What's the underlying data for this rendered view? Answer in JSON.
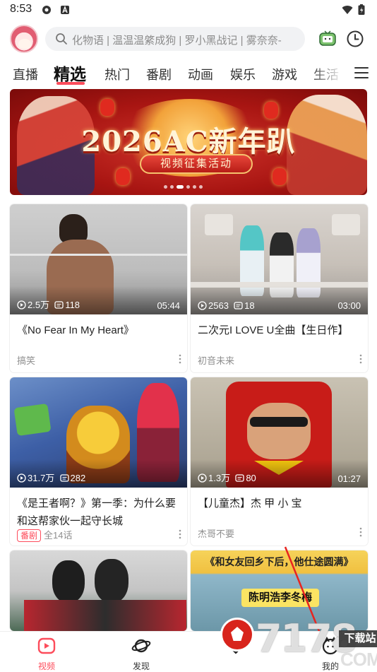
{
  "status_bar": {
    "time": "8:53"
  },
  "search": {
    "placeholder": "化物语 | 温温温綮成狗 | 罗小黑战记 | 雾奈奈-"
  },
  "tabs": [
    {
      "label": "直播"
    },
    {
      "label": "精选",
      "active": true
    },
    {
      "label": "热门"
    },
    {
      "label": "番剧"
    },
    {
      "label": "动画"
    },
    {
      "label": "娱乐"
    },
    {
      "label": "游戏"
    },
    {
      "label": "生活"
    }
  ],
  "banner": {
    "title": "2026AC新年趴",
    "subtitle": "视频征集活动",
    "page_count": 5,
    "current_page": 2
  },
  "videos": [
    {
      "title": "《No Fear In My Heart》",
      "views": "2.5万",
      "comments": "118",
      "duration": "05:44",
      "uploader": "搞笑"
    },
    {
      "title": "二次元I LOVE U全曲【生日作】",
      "views": "2563",
      "comments": "18",
      "duration": "03:00",
      "uploader": "初音未来"
    },
    {
      "title": "《是王者啊？》第一季：为什么要和这帮家伙一起守长城",
      "views": "31.7万",
      "comments": "282",
      "duration": "",
      "badge": "番剧",
      "uploader": "全14话"
    },
    {
      "title": "【儿童杰】杰 甲 小 宝",
      "views": "1.3万",
      "comments": "80",
      "duration": "01:27",
      "uploader": "杰哥不要"
    },
    {
      "title": "",
      "views": "",
      "comments": "",
      "duration": "",
      "uploader": "",
      "overlay_text": ""
    },
    {
      "title": "",
      "views": "",
      "comments": "",
      "duration": "",
      "uploader": "",
      "overlay_text": "《和女友回乡下后，他仕途圆满》",
      "overlay_name": "陈明浩李冬梅"
    }
  ],
  "bottom_nav": [
    {
      "label": "视频",
      "active": true
    },
    {
      "label": "发现"
    },
    {
      "label": ""
    },
    {
      "label": "我的"
    }
  ],
  "watermark": {
    "text": "7178",
    "tag": "下载站",
    "domain": "COM"
  },
  "colors": {
    "accent": "#fd4c5b",
    "banner_red": "#b81d17",
    "gold": "#f5c26e"
  }
}
